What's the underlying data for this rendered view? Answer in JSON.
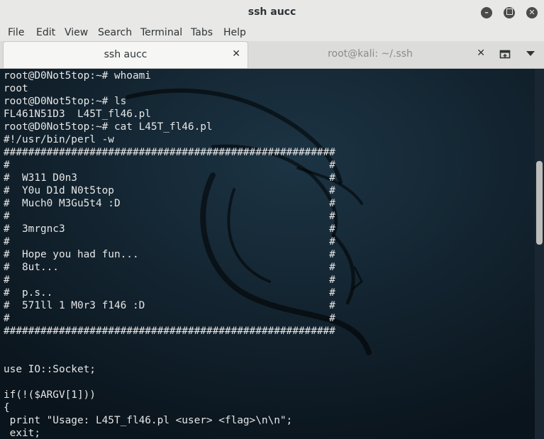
{
  "window": {
    "title": "ssh aucc"
  },
  "menu": [
    "File",
    "Edit",
    "View",
    "Search",
    "Terminal",
    "Tabs",
    "Help"
  ],
  "tabs": [
    {
      "label": "ssh aucc",
      "active": true
    },
    {
      "label": "root@kali: ~/.ssh",
      "active": false
    }
  ],
  "icons": {
    "minimize": "minimize-icon",
    "maximize": "maximize-icon",
    "close": "close-icon",
    "new_tab": "new-tab-icon",
    "tab_menu": "chevron-down-icon"
  },
  "colors": {
    "terminal_bg": "#0d1a24",
    "terminal_fg": "#e6e6e6",
    "chrome": "#e8e8e7"
  },
  "terminal": {
    "lines": [
      "root@D0Not5top:~# whoami",
      "root",
      "root@D0Not5top:~# ls",
      "FL461N51D3  L45T_fl46.pl",
      "root@D0Not5top:~# cat L45T_fl46.pl",
      "#!/usr/bin/perl -w",
      "######################################################",
      "#                                                    #",
      "#  W311 D0n3                                         #",
      "#  Y0u D1d N0t5top                                   #",
      "#  Much0 M3Gu5t4 :D                                  #",
      "#                                                    #",
      "#  3mrgnc3                                           #",
      "#                                                    #",
      "#  Hope you had fun...                               #",
      "#  8ut...                                            #",
      "#                                                    #",
      "#  p.s..                                             #",
      "#  571ll 1 M0r3 f146 :D                              #",
      "#                                                    #",
      "######################################################",
      "",
      "",
      "use IO::Socket;",
      "",
      "if(!($ARGV[1]))",
      "{",
      " print \"Usage: L45T_fl46.pl <user> <flag>\\n\\n\";",
      " exit;"
    ]
  }
}
